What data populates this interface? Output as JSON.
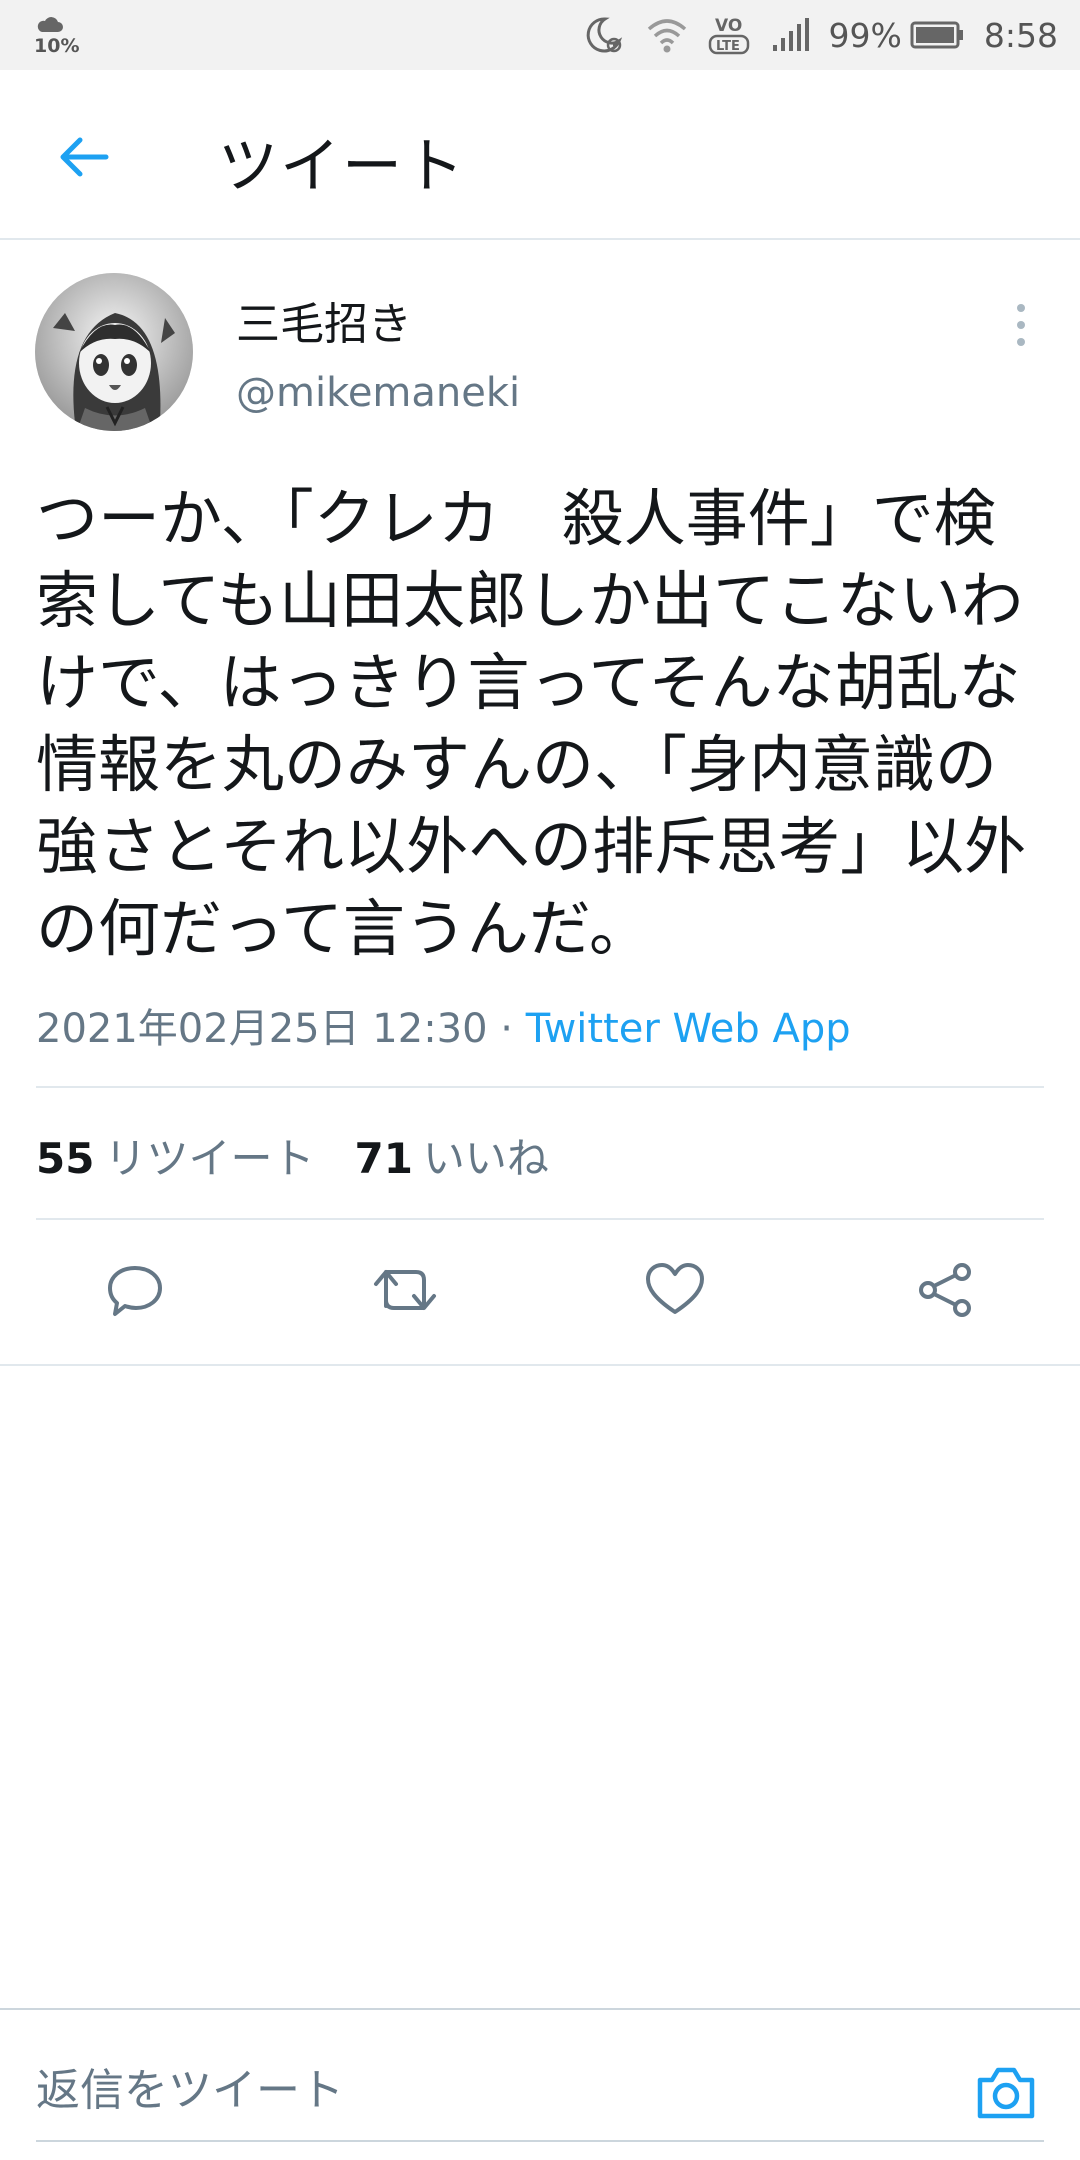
{
  "status_bar": {
    "temperature": "10%",
    "battery_percent": "99%",
    "time": "8:58",
    "network_badge": "VO LTE"
  },
  "header": {
    "title": "ツイート"
  },
  "tweet": {
    "display_name": "三毛招き",
    "handle": "@mikemaneki",
    "text": "つーか、「クレカ　殺人事件」で検索しても山田太郎しか出てこないわけで、はっきり言ってそんな胡乱な情報を丸のみすんの、「身内意識の強さとそれ以外への排斥思考」以外の何だって言うんだ。",
    "timestamp": "2021年02月25日 12:30",
    "separator": " · ",
    "source": "Twitter Web App",
    "retweet_count": "55",
    "retweet_label": "リツイート",
    "like_count": "71",
    "like_label": "いいね"
  },
  "reply_bar": {
    "placeholder": "返信をツイート"
  },
  "colors": {
    "accent": "#1da1f2",
    "muted": "#657786",
    "divider": "#e1e8ed"
  }
}
